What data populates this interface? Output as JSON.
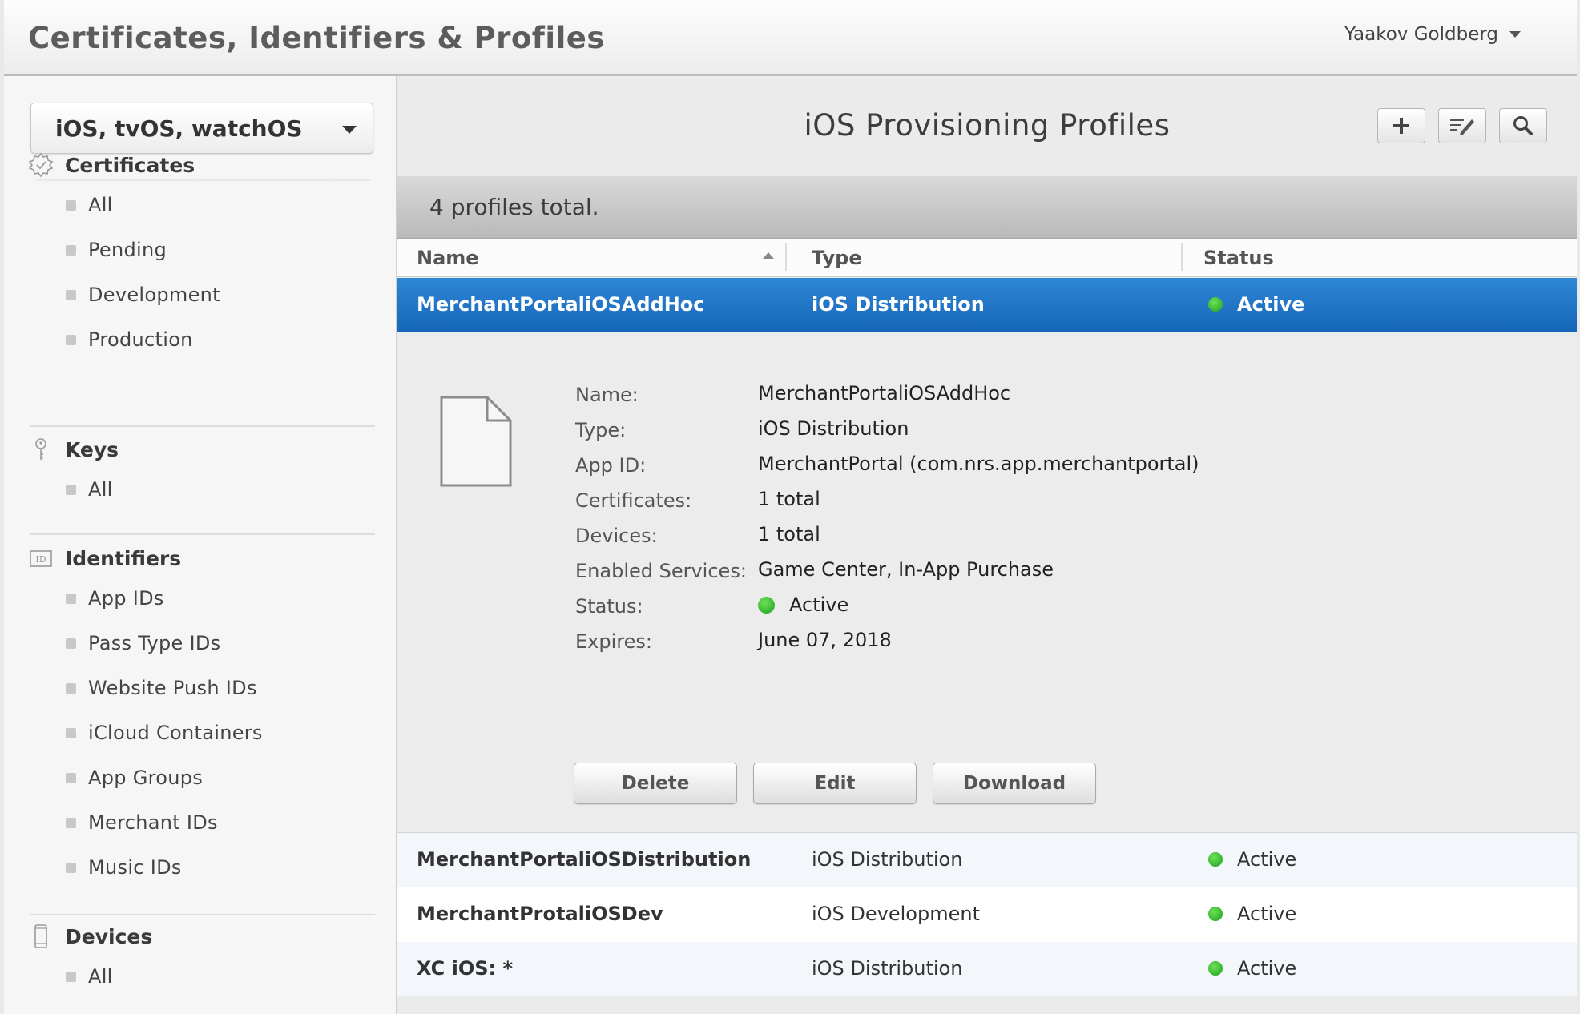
{
  "header": {
    "title": "Certificates, Identifiers & Profiles",
    "user": "Yaakov Goldberg"
  },
  "sidebar": {
    "platform": "iOS, tvOS, watchOS",
    "sections": [
      {
        "label": "Certificates",
        "icon": "certificate-icon",
        "items": [
          "All",
          "Pending",
          "Development",
          "Production"
        ]
      },
      {
        "label": "Keys",
        "icon": "key-icon",
        "items": [
          "All"
        ]
      },
      {
        "label": "Identifiers",
        "icon": "id-icon",
        "items": [
          "App IDs",
          "Pass Type IDs",
          "Website Push IDs",
          "iCloud Containers",
          "App Groups",
          "Merchant IDs",
          "Music IDs"
        ]
      },
      {
        "label": "Devices",
        "icon": "device-icon",
        "items": [
          "All"
        ]
      }
    ]
  },
  "main": {
    "title": "iOS Provisioning Profiles",
    "count_text": "4 profiles total.",
    "columns": [
      "Name",
      "Type",
      "Status"
    ],
    "rows": [
      {
        "name": "MerchantPortaliOSAddHoc",
        "type": "iOS Distribution",
        "status": "Active"
      },
      {
        "name": "MerchantPortaliOSDistribution",
        "type": "iOS Distribution",
        "status": "Active"
      },
      {
        "name": "MerchantProtaliOSDev",
        "type": "iOS Development",
        "status": "Active"
      },
      {
        "name": "XC iOS: *",
        "type": "iOS Distribution",
        "status": "Active"
      }
    ],
    "detail": {
      "fields": [
        {
          "label": "Name:",
          "value": "MerchantPortaliOSAddHoc"
        },
        {
          "label": "Type:",
          "value": "iOS Distribution"
        },
        {
          "label": "App ID:",
          "value": "MerchantPortal (com.nrs.app.merchantportal)"
        },
        {
          "label": "Certificates:",
          "value": "1 total"
        },
        {
          "label": "Devices:",
          "value": "1 total"
        },
        {
          "label": "Enabled Services:",
          "value": "Game Center, In-App Purchase"
        },
        {
          "label": "Status:",
          "value": "Active"
        },
        {
          "label": "Expires:",
          "value": "June 07, 2018"
        }
      ],
      "buttons": {
        "delete": "Delete",
        "edit": "Edit",
        "download": "Download"
      }
    }
  },
  "colors": {
    "selected_row": "#1f75c8",
    "status_active": "#22b022"
  }
}
